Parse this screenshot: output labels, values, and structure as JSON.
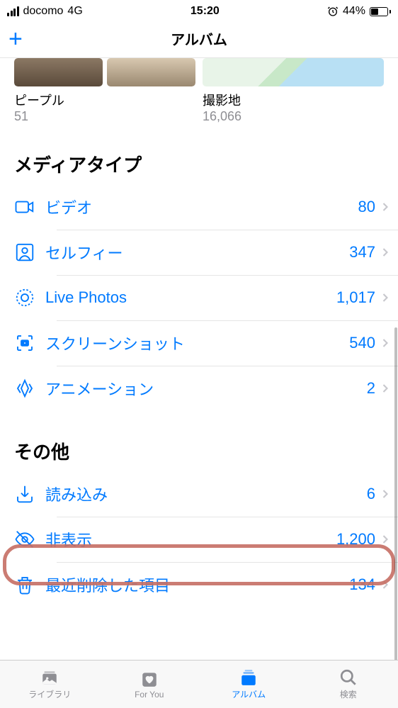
{
  "status": {
    "carrier": "docomo",
    "network": "4G",
    "time": "15:20",
    "battery_pct": "44%"
  },
  "nav": {
    "title": "アルバム"
  },
  "thumbs": {
    "people": {
      "label": "ピープル",
      "count": "51"
    },
    "places": {
      "label": "撮影地",
      "count": "16,066"
    }
  },
  "media_types": {
    "title": "メディアタイプ",
    "videos": {
      "label": "ビデオ",
      "count": "80"
    },
    "selfies": {
      "label": "セルフィー",
      "count": "347"
    },
    "live": {
      "label": "Live Photos",
      "count": "1,017"
    },
    "screenshots": {
      "label": "スクリーンショット",
      "count": "540"
    },
    "animated": {
      "label": "アニメーション",
      "count": "2"
    }
  },
  "other": {
    "title": "その他",
    "imports": {
      "label": "読み込み",
      "count": "6"
    },
    "hidden": {
      "label": "非表示",
      "count": "1,200"
    },
    "deleted": {
      "label": "最近削除した項目",
      "count": "134"
    }
  },
  "tabs": {
    "library": "ライブラリ",
    "foryou": "For You",
    "albums": "アルバム",
    "search": "検索"
  }
}
